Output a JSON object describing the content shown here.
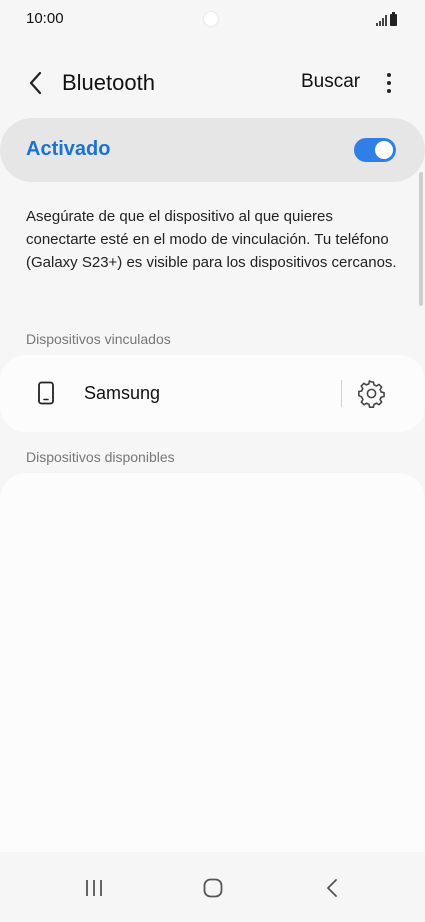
{
  "status_bar": {
    "time": "10:00"
  },
  "header": {
    "title": "Bluetooth",
    "search_label": "Buscar",
    "back_icon": "chevron-left-icon",
    "more_icon": "more-vert-icon"
  },
  "bluetooth_toggle": {
    "label": "Activado",
    "enabled": true,
    "accent_color": "#1a73d4"
  },
  "description": "Asegúrate de que el dispositivo al que quieres conectarte esté en el modo de vinculación. Tu teléfono (Galaxy S23+) es visible para los dispositivos cercanos.",
  "paired_devices": {
    "header": "Dispositivos vinculados",
    "items": [
      {
        "name": "Samsung",
        "icon": "smartphone-icon",
        "settings_icon": "gear-icon"
      }
    ]
  },
  "available_devices": {
    "header": "Dispositivos disponibles",
    "items": []
  },
  "navigation_bar": {
    "recents_icon": "recents-icon",
    "home_icon": "home-icon",
    "back_icon": "back-icon"
  }
}
